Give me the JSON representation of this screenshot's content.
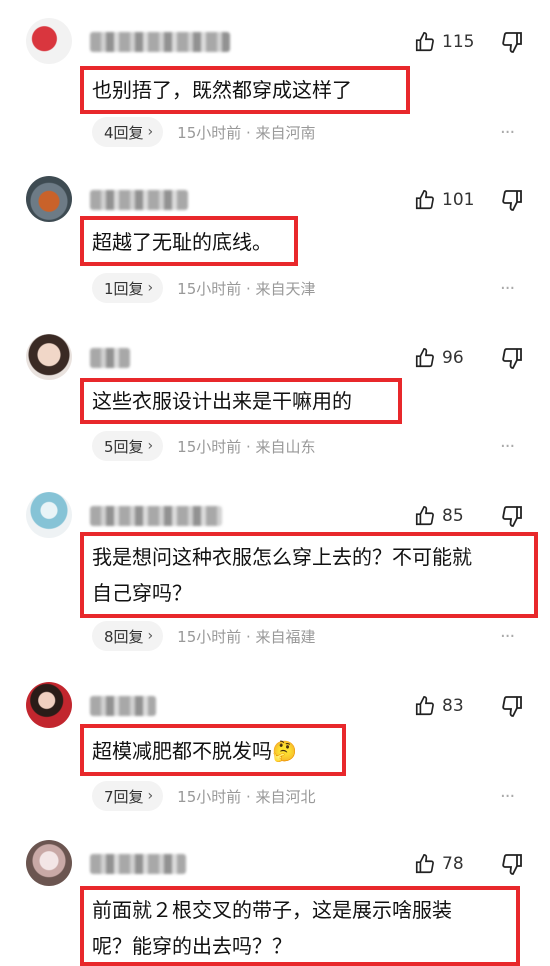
{
  "comments": [
    {
      "likes": "115",
      "text": [
        "也别捂了，既然都穿成这样了"
      ],
      "reply_label": "4回复",
      "time": "15小时前 · 来自河南"
    },
    {
      "likes": "101",
      "text": [
        "超越了无耻的底线。"
      ],
      "reply_label": "1回复",
      "time": "15小时前 · 来自天津"
    },
    {
      "likes": "96",
      "text": [
        "这些衣服设计出来是干嘛用的"
      ],
      "reply_label": "5回复",
      "time": "15小时前 · 来自山东"
    },
    {
      "likes": "85",
      "text": [
        "我是想问这种衣服怎么穿上去的？不可能就",
        "自己穿吗？"
      ],
      "reply_label": "8回复",
      "time": "15小时前 · 来自福建"
    },
    {
      "likes": "83",
      "text": [
        "超模减肥都不脱发吗🤔"
      ],
      "reply_label": "7回复",
      "time": "15小时前 · 来自河北"
    },
    {
      "likes": "78",
      "text": [
        "前面就２根交叉的带子，这是展示啥服装",
        "呢？能穿的出去吗？？"
      ],
      "reply_label": "",
      "time": ""
    }
  ],
  "icons": {
    "like": "thumbs-up-outline-icon",
    "dislike": "thumbs-down-outline-icon",
    "more": "more-dots-icon",
    "chevron": "chevron-right-icon"
  },
  "colors": {
    "highlight_border": "#e8282b",
    "meta_text": "#999999",
    "reply_bg": "#f3f3f3"
  }
}
